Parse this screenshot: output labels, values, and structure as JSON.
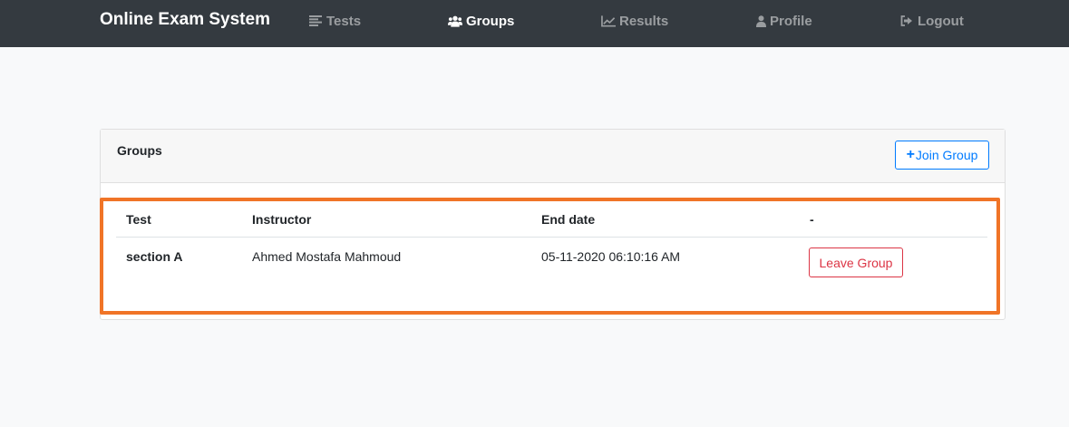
{
  "navbar": {
    "brand": "Online Exam System",
    "items": [
      {
        "label": "Tests",
        "icon": "list-icon",
        "active": false
      },
      {
        "label": "Groups",
        "icon": "users-icon",
        "active": true
      },
      {
        "label": "Results",
        "icon": "chart-line-icon",
        "active": false
      },
      {
        "label": "Profile",
        "icon": "user-icon",
        "active": false
      },
      {
        "label": "Logout",
        "icon": "sign-out-icon",
        "active": false
      }
    ]
  },
  "card": {
    "title": "Groups",
    "join_button": {
      "icon_text": "+",
      "label": "Join Group"
    }
  },
  "table": {
    "headers": [
      "Test",
      "Instructor",
      "End date",
      "-"
    ],
    "rows": [
      {
        "test": "section A",
        "instructor": "Ahmed Mostafa Mahmoud",
        "end_date": "05-11-2020 06:10:16 AM",
        "action": "Leave Group"
      }
    ]
  },
  "colors": {
    "navbar_bg": "#343a40",
    "primary": "#007bff",
    "danger": "#dc3545",
    "highlight": "#f07427"
  }
}
